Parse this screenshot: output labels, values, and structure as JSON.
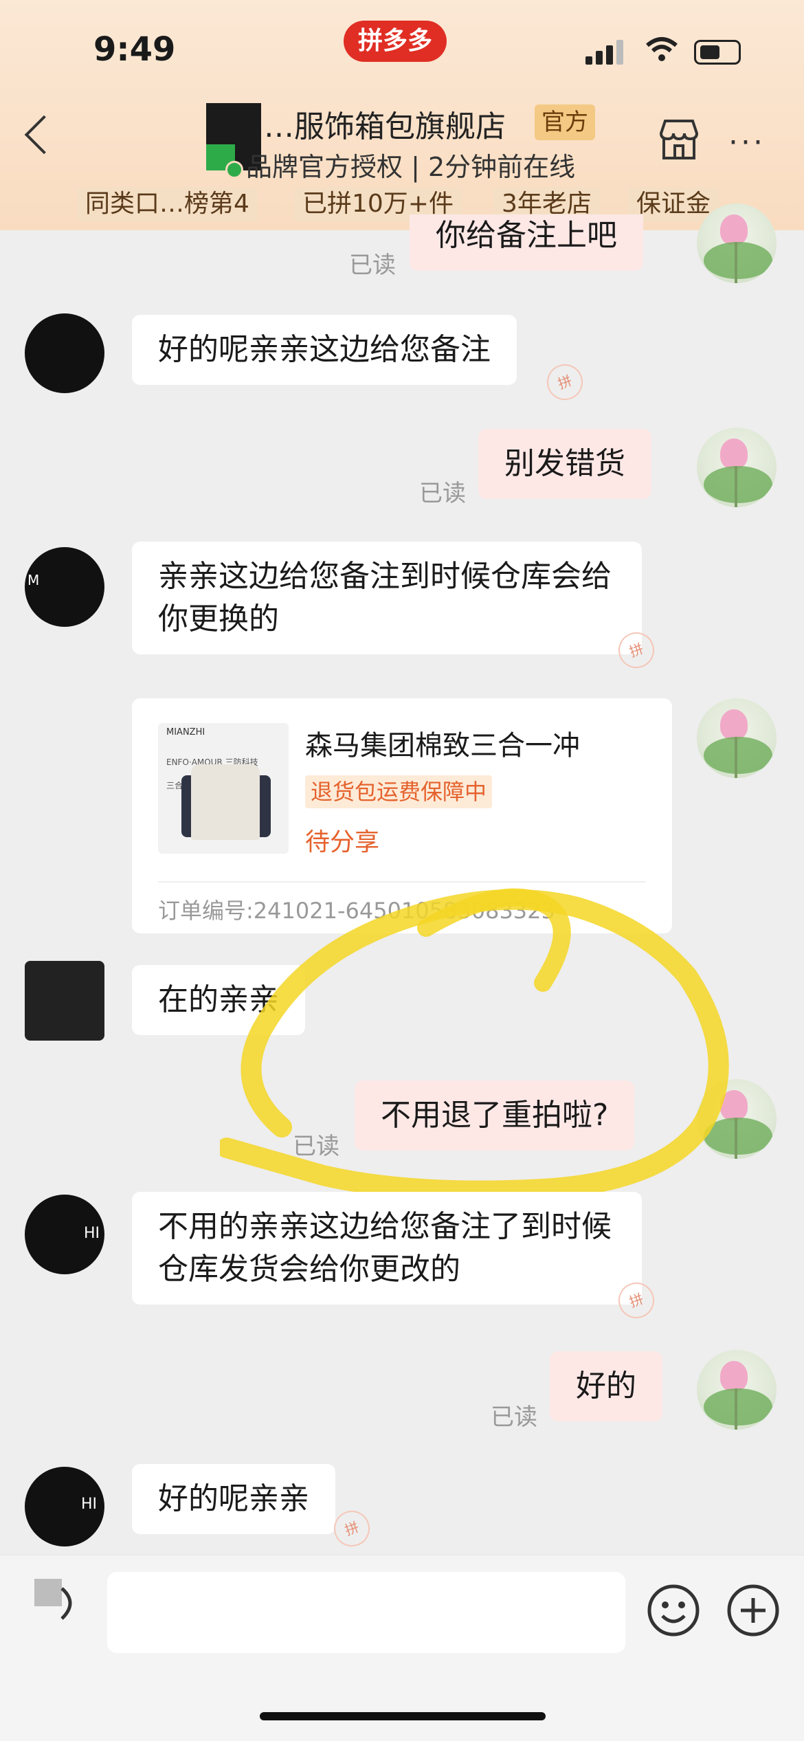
{
  "status_bar": {
    "time": "9:49",
    "app_badge": "拼多多"
  },
  "header": {
    "shop_name": "…服饰箱包旗舰店",
    "official_badge": "官方",
    "subtitle": "品牌官方授权 | 2分钟前在线",
    "tags": [
      "同类口…榜第4",
      "已拼10万+件",
      "3年老店",
      "保证金"
    ]
  },
  "messages": [
    {
      "from": "me",
      "text": "你给备注上吧",
      "read": "已读"
    },
    {
      "from": "shop",
      "text": "好的呢亲亲这边给您备注"
    },
    {
      "from": "me",
      "text": "别发错货",
      "read": "已读"
    },
    {
      "from": "shop",
      "text": "亲亲这边给您备注到时候仓库会给你更换的"
    },
    {
      "from": "shop",
      "text": "在的亲亲"
    },
    {
      "from": "me",
      "text": "不用退了重拍啦?",
      "read": "已读"
    },
    {
      "from": "shop",
      "text": "不用的亲亲这边给您备注了到时候仓库发货会给你更改的"
    },
    {
      "from": "me",
      "text": "好的",
      "read": "已读"
    },
    {
      "from": "shop",
      "text": "好的呢亲亲"
    }
  ],
  "order_card": {
    "title": "森马集团棉致三合一冲",
    "return_label": "退货包运费保障中",
    "status": "待分享",
    "order_no": "订单编号:241021-645010583083323",
    "image_brand": "MIANZHI",
    "image_sub": "ENFO·AMOUR 三防科技",
    "image_sub2": "三合一"
  },
  "avatar_labels": {
    "m1": "M",
    "hi": "HI"
  },
  "watermark": "拼",
  "input": {
    "placeholder": ""
  },
  "colors": {
    "accent": "#e02e24",
    "me_bubble": "#fde8e6",
    "highlight": "#f5d624"
  }
}
